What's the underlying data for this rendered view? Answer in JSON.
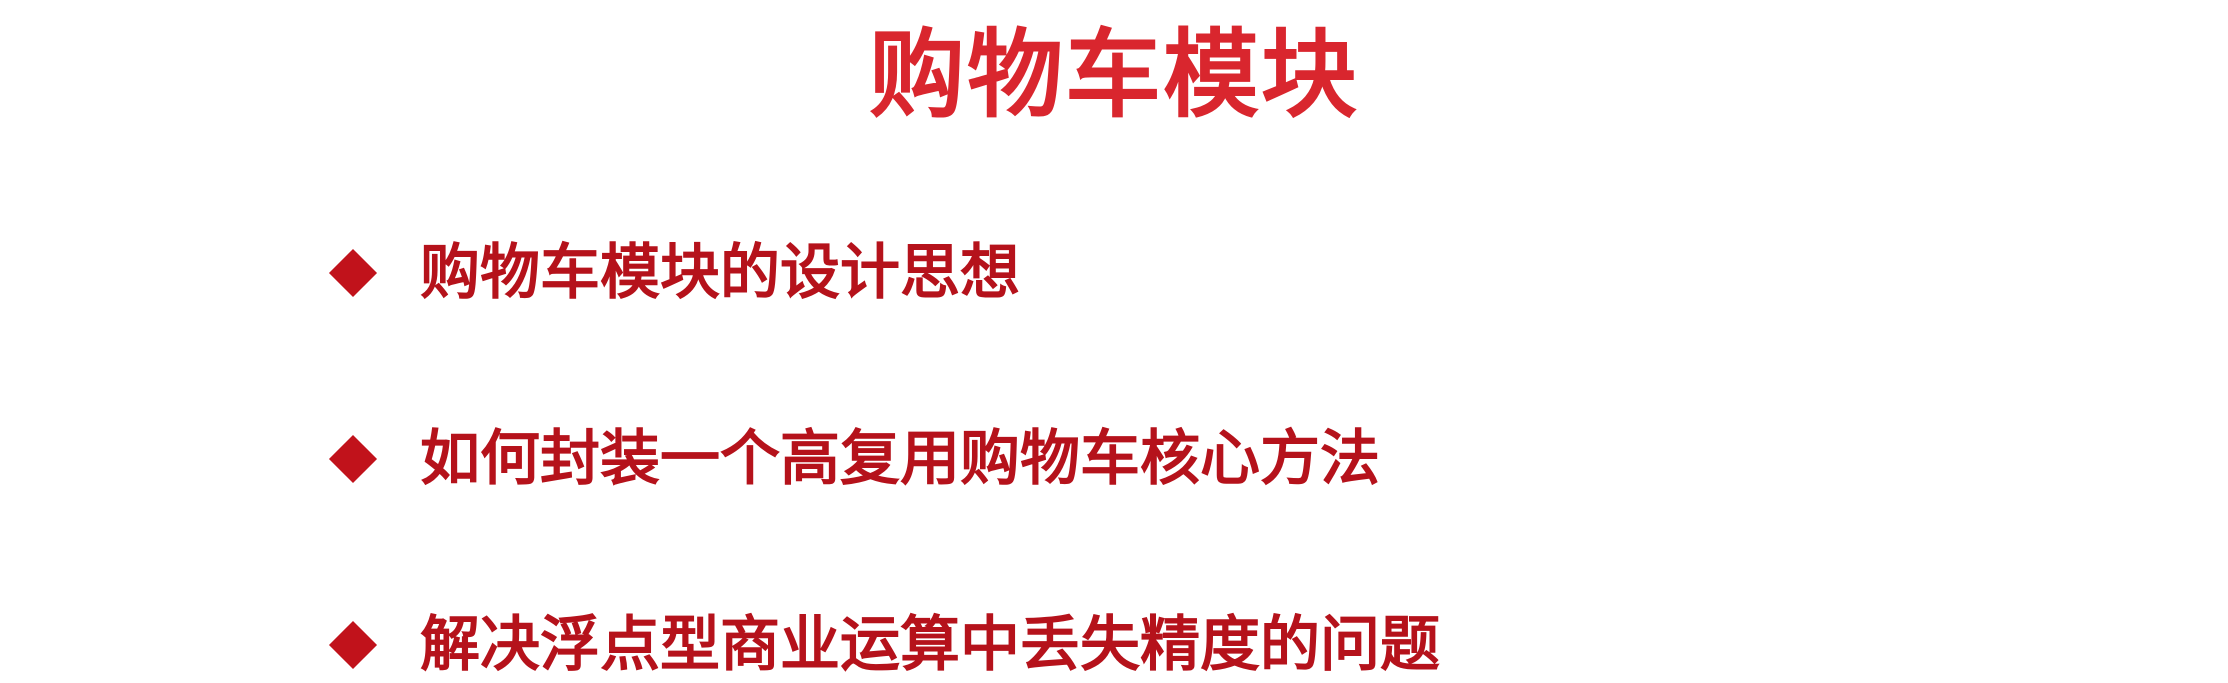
{
  "colors": {
    "title": "#d9262e",
    "bullet_text": "#b5121b",
    "bullet_marker": "#c1121b"
  },
  "slide": {
    "title": "购物车模块",
    "bullets": [
      {
        "marker_icon": "diamond-icon",
        "text": "购物车模块的设计思想"
      },
      {
        "marker_icon": "diamond-icon",
        "text": "如何封装一个高复用购物车核心方法"
      },
      {
        "marker_icon": "diamond-icon",
        "text": "解决浮点型商业运算中丢失精度的问题"
      }
    ]
  }
}
